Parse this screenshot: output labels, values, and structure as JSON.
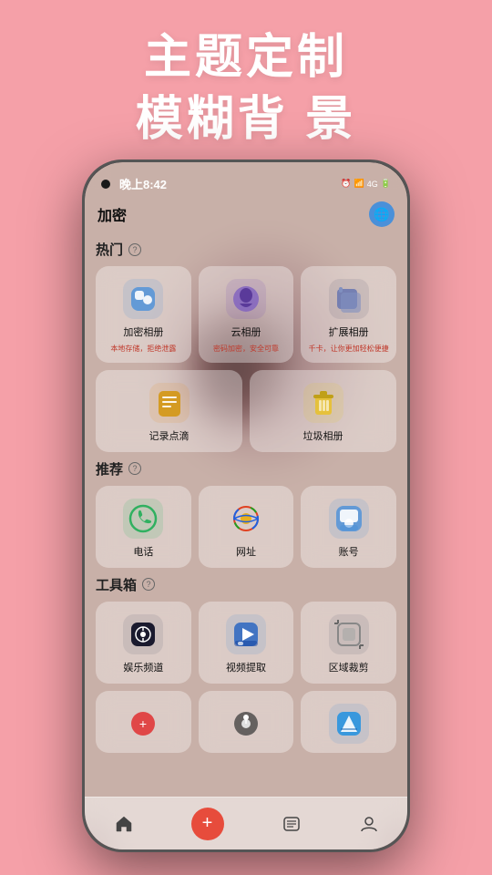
{
  "header": {
    "line1": "主题定制",
    "line2": "模糊背 景"
  },
  "statusBar": {
    "time": "晚上8:42",
    "icons": "📶🔋"
  },
  "topBar": {
    "title": "加密",
    "icon": "🌐"
  },
  "sections": [
    {
      "id": "hot",
      "label": "热门",
      "apps": [
        {
          "id": "encrypted-album",
          "label": "加密相册",
          "sublabel": "本地存储，拒绝泄露",
          "iconType": "blue",
          "emoji": "🔐"
        },
        {
          "id": "cloud-album",
          "label": "云相册",
          "sublabel": "密码加密，安全可靠",
          "iconType": "purple",
          "emoji": "🎩"
        },
        {
          "id": "expand-album",
          "label": "扩展相册",
          "sublabel": "千卡，让你更加轻松便捷",
          "iconType": "gray",
          "emoji": "📁"
        }
      ],
      "apps2": [
        {
          "id": "notes",
          "label": "记录点滴",
          "iconType": "orange",
          "emoji": "📋"
        },
        {
          "id": "trash-album",
          "label": "垃圾相册",
          "iconType": "yellow",
          "emoji": "🗑️"
        }
      ]
    },
    {
      "id": "recommend",
      "label": "推荐",
      "apps": [
        {
          "id": "phone",
          "label": "电话",
          "iconType": "green",
          "emoji": "📞"
        },
        {
          "id": "website",
          "label": "网址",
          "iconType": "orange",
          "emoji": "🌐"
        },
        {
          "id": "account",
          "label": "账号",
          "iconType": "blue",
          "emoji": "👤"
        }
      ]
    },
    {
      "id": "tools",
      "label": "工具箱",
      "apps": [
        {
          "id": "entertainment",
          "label": "娱乐频道",
          "iconType": "gray",
          "emoji": "🎵"
        },
        {
          "id": "video-extract",
          "label": "视频提取",
          "iconType": "blue",
          "emoji": "▶️"
        },
        {
          "id": "crop",
          "label": "区域裁剪",
          "iconType": "gray",
          "emoji": "✂️"
        }
      ]
    }
  ],
  "bottomNav": [
    {
      "id": "home",
      "icon": "🏠",
      "label": ""
    },
    {
      "id": "add",
      "icon": "+",
      "label": ""
    },
    {
      "id": "list",
      "icon": "📋",
      "label": ""
    },
    {
      "id": "profile",
      "icon": "👤",
      "label": ""
    }
  ]
}
